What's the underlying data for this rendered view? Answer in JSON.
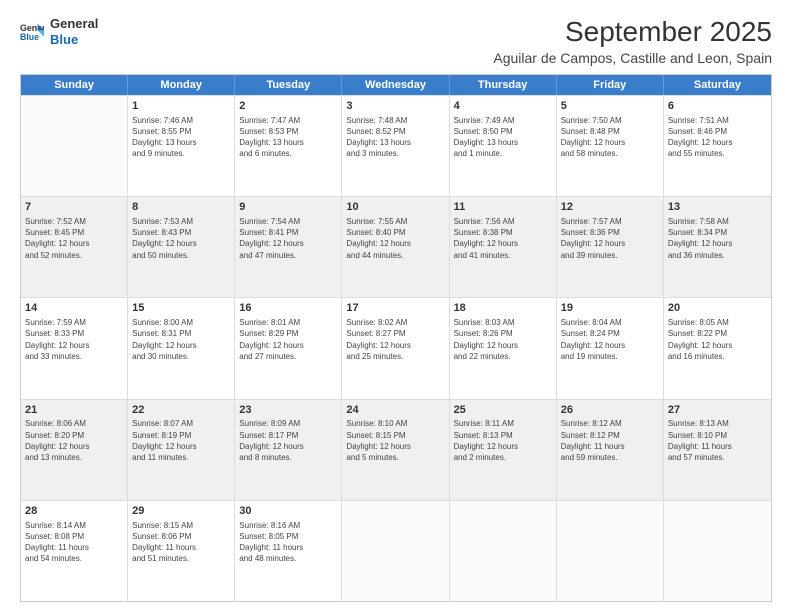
{
  "header": {
    "logo": {
      "line1": "General",
      "line2": "Blue"
    },
    "title": "September 2025",
    "subtitle": "Aguilar de Campos, Castille and Leon, Spain"
  },
  "calendar": {
    "days": [
      "Sunday",
      "Monday",
      "Tuesday",
      "Wednesday",
      "Thursday",
      "Friday",
      "Saturday"
    ],
    "rows": [
      [
        {
          "day": "",
          "info": ""
        },
        {
          "day": "1",
          "info": "Sunrise: 7:46 AM\nSunset: 8:55 PM\nDaylight: 13 hours\nand 9 minutes."
        },
        {
          "day": "2",
          "info": "Sunrise: 7:47 AM\nSunset: 8:53 PM\nDaylight: 13 hours\nand 6 minutes."
        },
        {
          "day": "3",
          "info": "Sunrise: 7:48 AM\nSunset: 8:52 PM\nDaylight: 13 hours\nand 3 minutes."
        },
        {
          "day": "4",
          "info": "Sunrise: 7:49 AM\nSunset: 8:50 PM\nDaylight: 13 hours\nand 1 minute."
        },
        {
          "day": "5",
          "info": "Sunrise: 7:50 AM\nSunset: 8:48 PM\nDaylight: 12 hours\nand 58 minutes."
        },
        {
          "day": "6",
          "info": "Sunrise: 7:51 AM\nSunset: 8:46 PM\nDaylight: 12 hours\nand 55 minutes."
        }
      ],
      [
        {
          "day": "7",
          "info": "Sunrise: 7:52 AM\nSunset: 8:45 PM\nDaylight: 12 hours\nand 52 minutes."
        },
        {
          "day": "8",
          "info": "Sunrise: 7:53 AM\nSunset: 8:43 PM\nDaylight: 12 hours\nand 50 minutes."
        },
        {
          "day": "9",
          "info": "Sunrise: 7:54 AM\nSunset: 8:41 PM\nDaylight: 12 hours\nand 47 minutes."
        },
        {
          "day": "10",
          "info": "Sunrise: 7:55 AM\nSunset: 8:40 PM\nDaylight: 12 hours\nand 44 minutes."
        },
        {
          "day": "11",
          "info": "Sunrise: 7:56 AM\nSunset: 8:38 PM\nDaylight: 12 hours\nand 41 minutes."
        },
        {
          "day": "12",
          "info": "Sunrise: 7:57 AM\nSunset: 8:36 PM\nDaylight: 12 hours\nand 39 minutes."
        },
        {
          "day": "13",
          "info": "Sunrise: 7:58 AM\nSunset: 8:34 PM\nDaylight: 12 hours\nand 36 minutes."
        }
      ],
      [
        {
          "day": "14",
          "info": "Sunrise: 7:59 AM\nSunset: 8:33 PM\nDaylight: 12 hours\nand 33 minutes."
        },
        {
          "day": "15",
          "info": "Sunrise: 8:00 AM\nSunset: 8:31 PM\nDaylight: 12 hours\nand 30 minutes."
        },
        {
          "day": "16",
          "info": "Sunrise: 8:01 AM\nSunset: 8:29 PM\nDaylight: 12 hours\nand 27 minutes."
        },
        {
          "day": "17",
          "info": "Sunrise: 8:02 AM\nSunset: 8:27 PM\nDaylight: 12 hours\nand 25 minutes."
        },
        {
          "day": "18",
          "info": "Sunrise: 8:03 AM\nSunset: 8:26 PM\nDaylight: 12 hours\nand 22 minutes."
        },
        {
          "day": "19",
          "info": "Sunrise: 8:04 AM\nSunset: 8:24 PM\nDaylight: 12 hours\nand 19 minutes."
        },
        {
          "day": "20",
          "info": "Sunrise: 8:05 AM\nSunset: 8:22 PM\nDaylight: 12 hours\nand 16 minutes."
        }
      ],
      [
        {
          "day": "21",
          "info": "Sunrise: 8:06 AM\nSunset: 8:20 PM\nDaylight: 12 hours\nand 13 minutes."
        },
        {
          "day": "22",
          "info": "Sunrise: 8:07 AM\nSunset: 8:19 PM\nDaylight: 12 hours\nand 11 minutes."
        },
        {
          "day": "23",
          "info": "Sunrise: 8:09 AM\nSunset: 8:17 PM\nDaylight: 12 hours\nand 8 minutes."
        },
        {
          "day": "24",
          "info": "Sunrise: 8:10 AM\nSunset: 8:15 PM\nDaylight: 12 hours\nand 5 minutes."
        },
        {
          "day": "25",
          "info": "Sunrise: 8:11 AM\nSunset: 8:13 PM\nDaylight: 12 hours\nand 2 minutes."
        },
        {
          "day": "26",
          "info": "Sunrise: 8:12 AM\nSunset: 8:12 PM\nDaylight: 11 hours\nand 59 minutes."
        },
        {
          "day": "27",
          "info": "Sunrise: 8:13 AM\nSunset: 8:10 PM\nDaylight: 11 hours\nand 57 minutes."
        }
      ],
      [
        {
          "day": "28",
          "info": "Sunrise: 8:14 AM\nSunset: 8:08 PM\nDaylight: 11 hours\nand 54 minutes."
        },
        {
          "day": "29",
          "info": "Sunrise: 8:15 AM\nSunset: 8:06 PM\nDaylight: 11 hours\nand 51 minutes."
        },
        {
          "day": "30",
          "info": "Sunrise: 8:16 AM\nSunset: 8:05 PM\nDaylight: 11 hours\nand 48 minutes."
        },
        {
          "day": "",
          "info": ""
        },
        {
          "day": "",
          "info": ""
        },
        {
          "day": "",
          "info": ""
        },
        {
          "day": "",
          "info": ""
        }
      ]
    ]
  }
}
